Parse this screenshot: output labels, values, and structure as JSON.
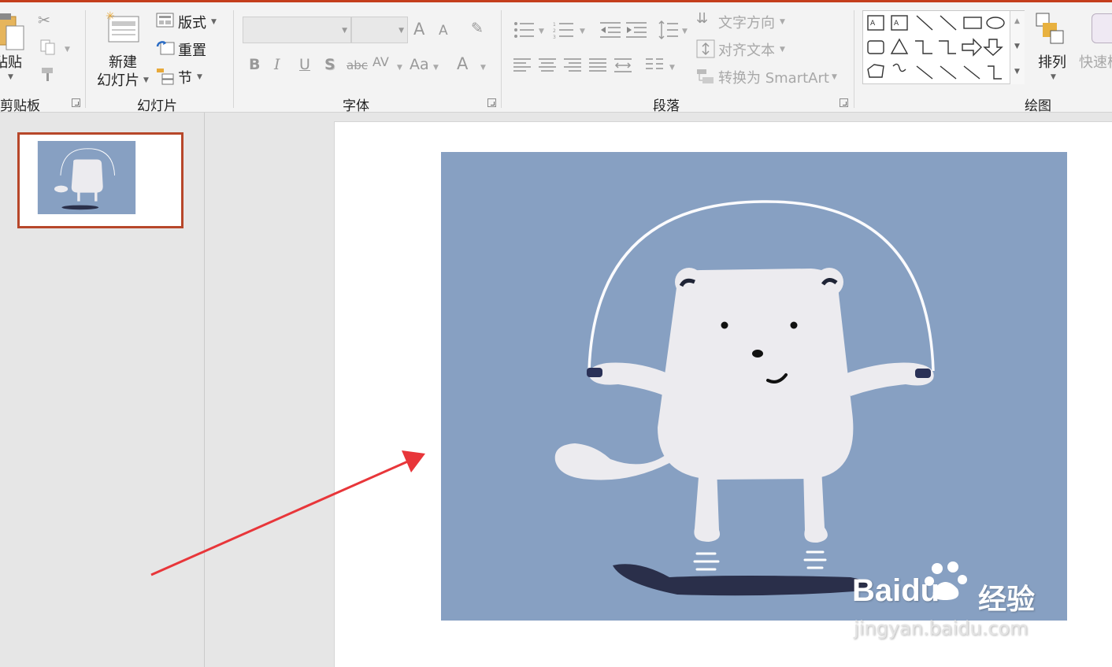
{
  "ribbon": {
    "clipboard": {
      "paste_label": "粘贴",
      "group_label": "剪贴板"
    },
    "slides": {
      "new_slide_line1": "新建",
      "new_slide_line2": "幻灯片",
      "layout_label": "版式",
      "reset_label": "重置",
      "section_label": "节",
      "group_label": "幻灯片"
    },
    "font": {
      "font_name_value": "",
      "font_size_value": "",
      "grow_glyph": "A",
      "shrink_glyph": "A",
      "bold_glyph": "B",
      "italic_glyph": "I",
      "underline_glyph": "U",
      "shadow_glyph": "S",
      "strike_glyph": "abc",
      "spacing_glyph": "AV",
      "case_glyph": "Aa",
      "color_glyph": "A",
      "group_label": "字体"
    },
    "paragraph": {
      "text_direction_label": "文字方向",
      "align_text_label": "对齐文本",
      "smartart_label": "转换为 SmartArt",
      "group_label": "段落"
    },
    "drawing": {
      "arrange_label": "排列",
      "quick_styles_label": "快速样",
      "group_label": "绘图"
    }
  },
  "watermark": {
    "brand": "Baidu",
    "brand_suffix": "经验",
    "url": "jingyan.baidu.com"
  },
  "colors": {
    "accent": "#c43e1c",
    "thumb_border": "#b7472a",
    "slide_bg_blue": "#87a0c2",
    "arrow": "#e8363a"
  }
}
